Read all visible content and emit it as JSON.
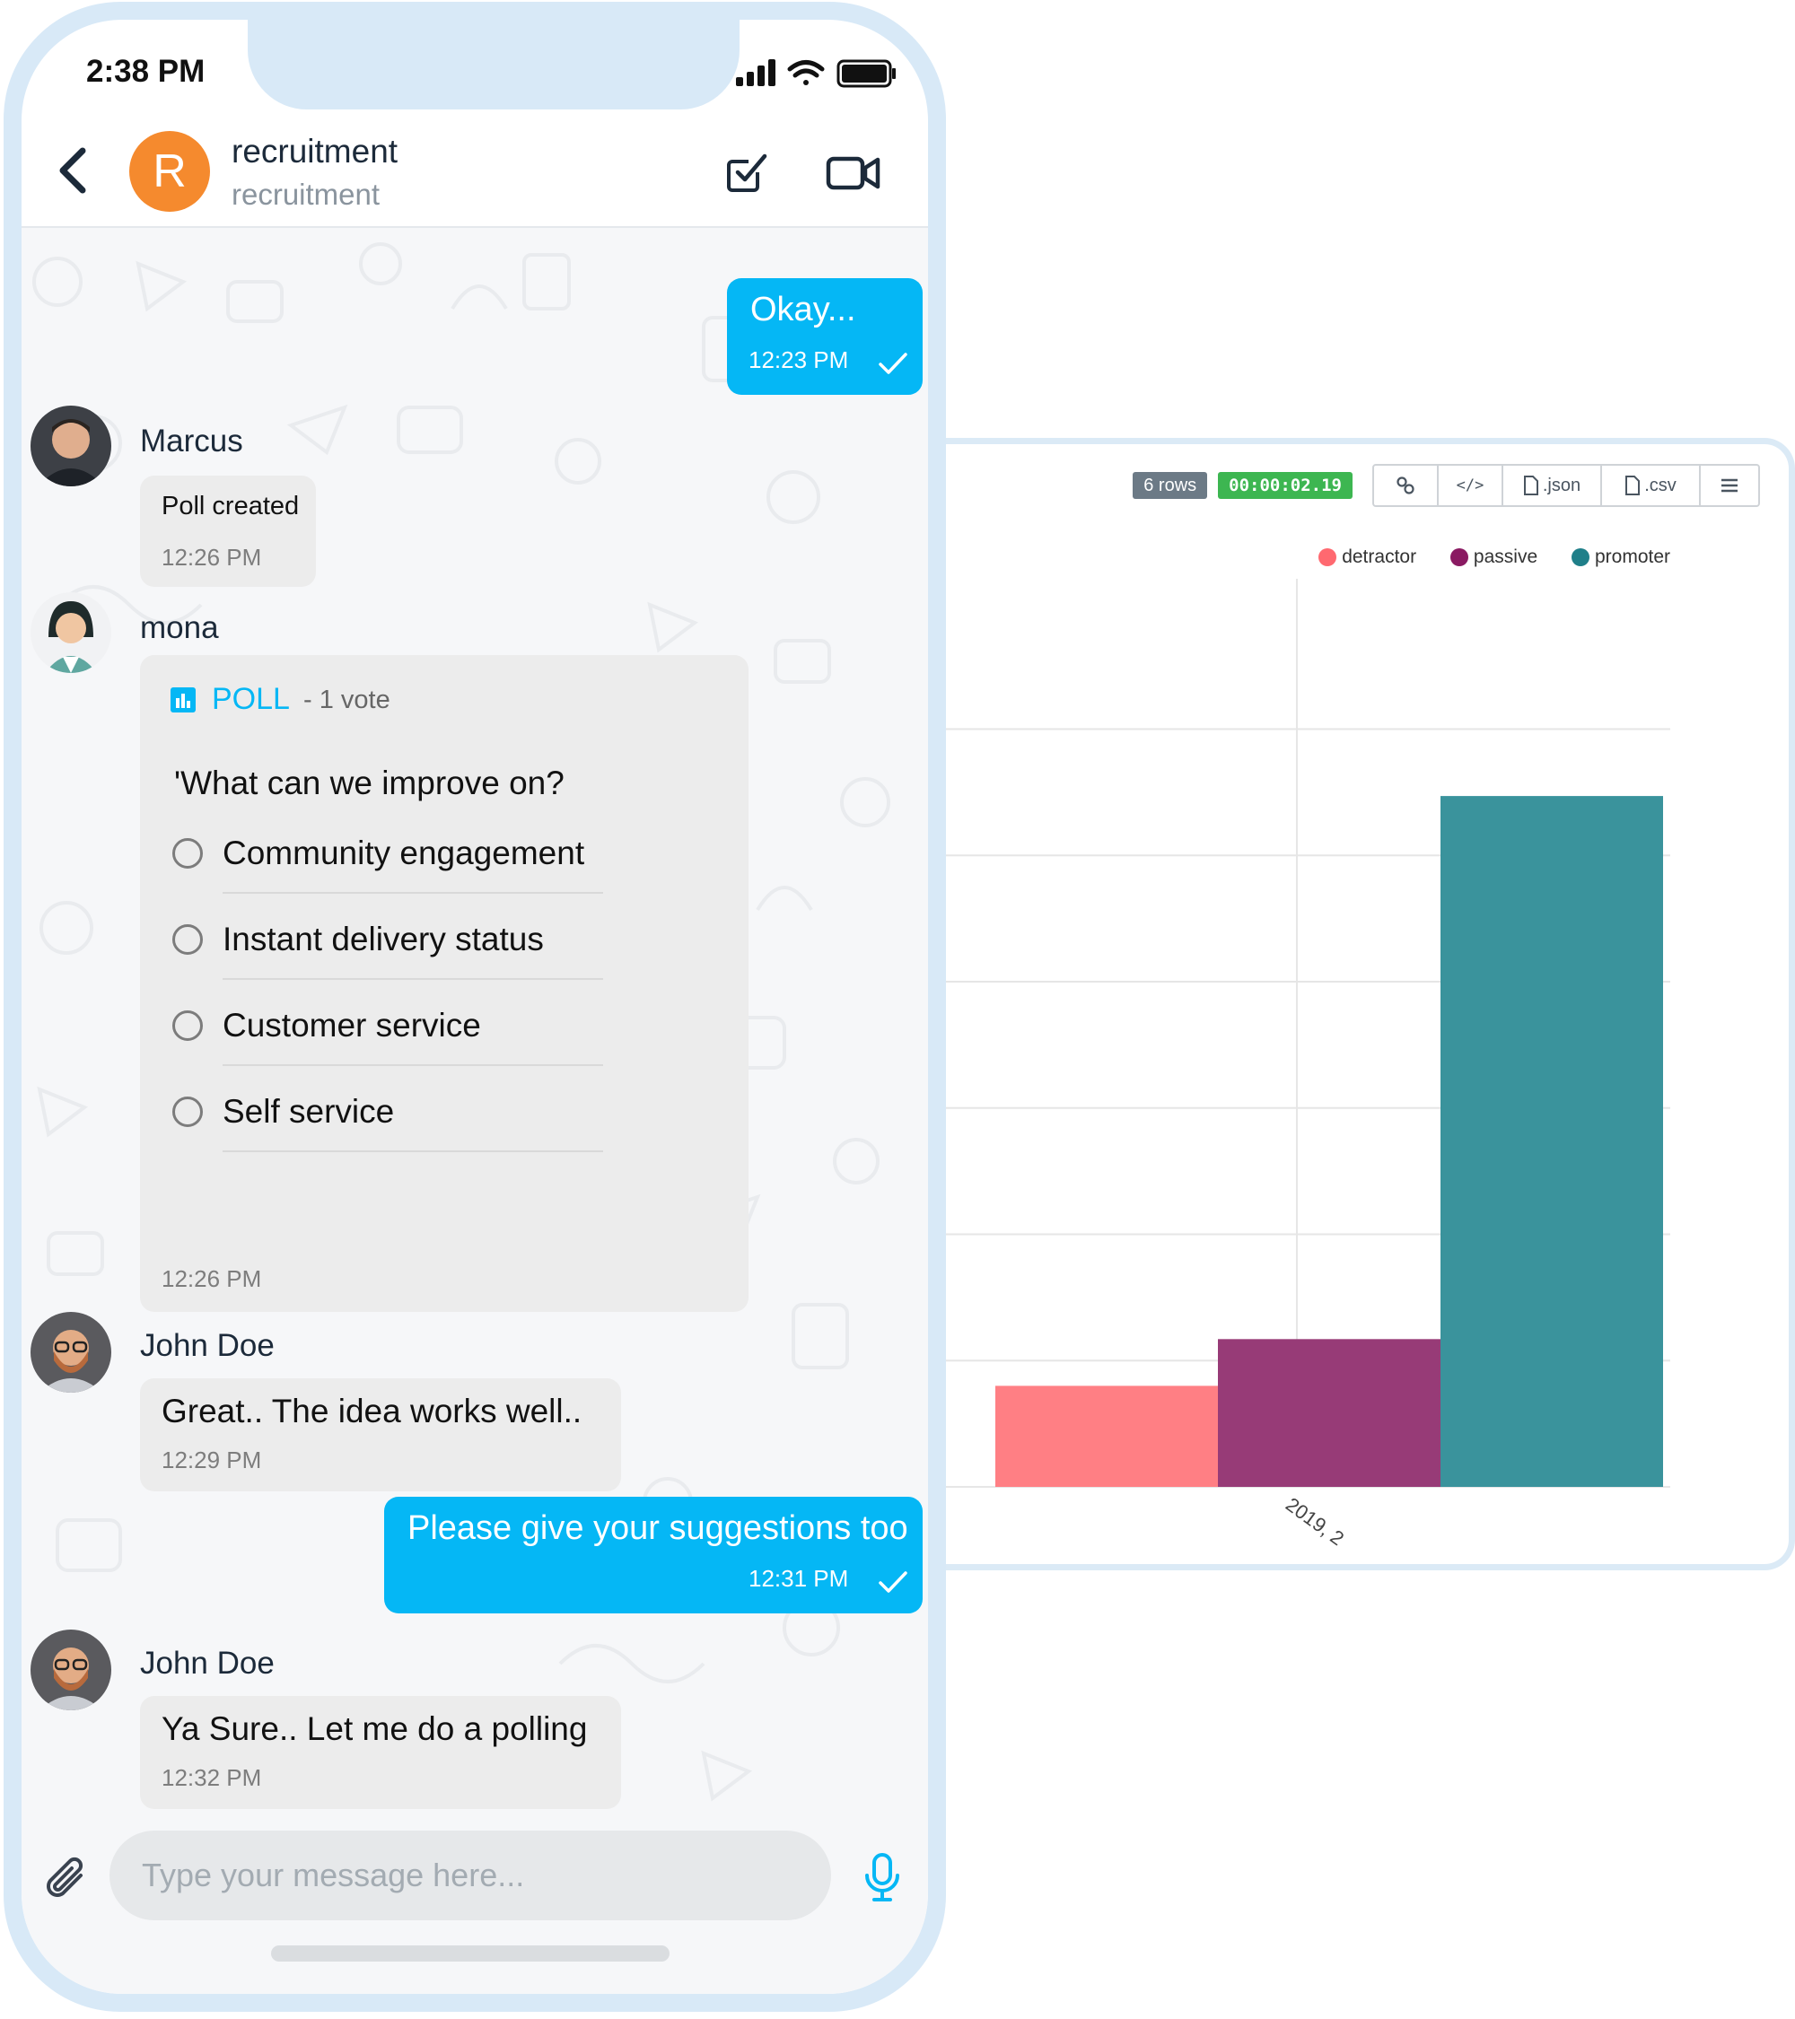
{
  "status_bar": {
    "time": "2:38 PM"
  },
  "header": {
    "avatar_letter": "R",
    "title": "recruitment",
    "subtitle": "recruitment"
  },
  "messages": [
    {
      "text": "Okay...",
      "time": "12:23 PM"
    },
    {
      "sender": "Marcus",
      "text": "Poll created",
      "time": "12:26 PM"
    },
    {
      "sender": "mona",
      "time": "12:26 PM"
    },
    {
      "sender": "John Doe",
      "text": "Great.. The idea works well..",
      "time": "12:29 PM"
    },
    {
      "text": "Please give your suggestions too",
      "time": "12:31 PM"
    },
    {
      "sender": "John Doe",
      "text": "Ya Sure.. Let me do a polling",
      "time": "12:32 PM"
    }
  ],
  "poll": {
    "label": "POLL",
    "votes": "- 1 vote",
    "question": "'What can we improve on?",
    "options": [
      "Community engagement",
      "Instant delivery status",
      "Customer service",
      "Self service"
    ]
  },
  "composer": {
    "placeholder": "Type your message here..."
  },
  "toolbar": {
    "rows": "6 rows",
    "elapsed": "00:00:02.19",
    "json_label": ".json",
    "csv_label": ".csv"
  },
  "colors": {
    "accent": "#05b7f5",
    "avatar": "#f58a2e",
    "detractor": "#ff7f84",
    "passive": "#973b77",
    "promoter": "#3a939c"
  },
  "chart_data": {
    "type": "bar",
    "categories": [
      "2019, 2"
    ],
    "series": [
      {
        "name": "detractor",
        "values": [
          8
        ]
      },
      {
        "name": "passive",
        "values": [
          11.7
        ]
      },
      {
        "name": "promoter",
        "values": [
          54.7
        ]
      }
    ],
    "title": "",
    "xlabel": "",
    "ylabel": "",
    "ylim": [
      0,
      60
    ],
    "grid": true,
    "legend": "top-right"
  }
}
